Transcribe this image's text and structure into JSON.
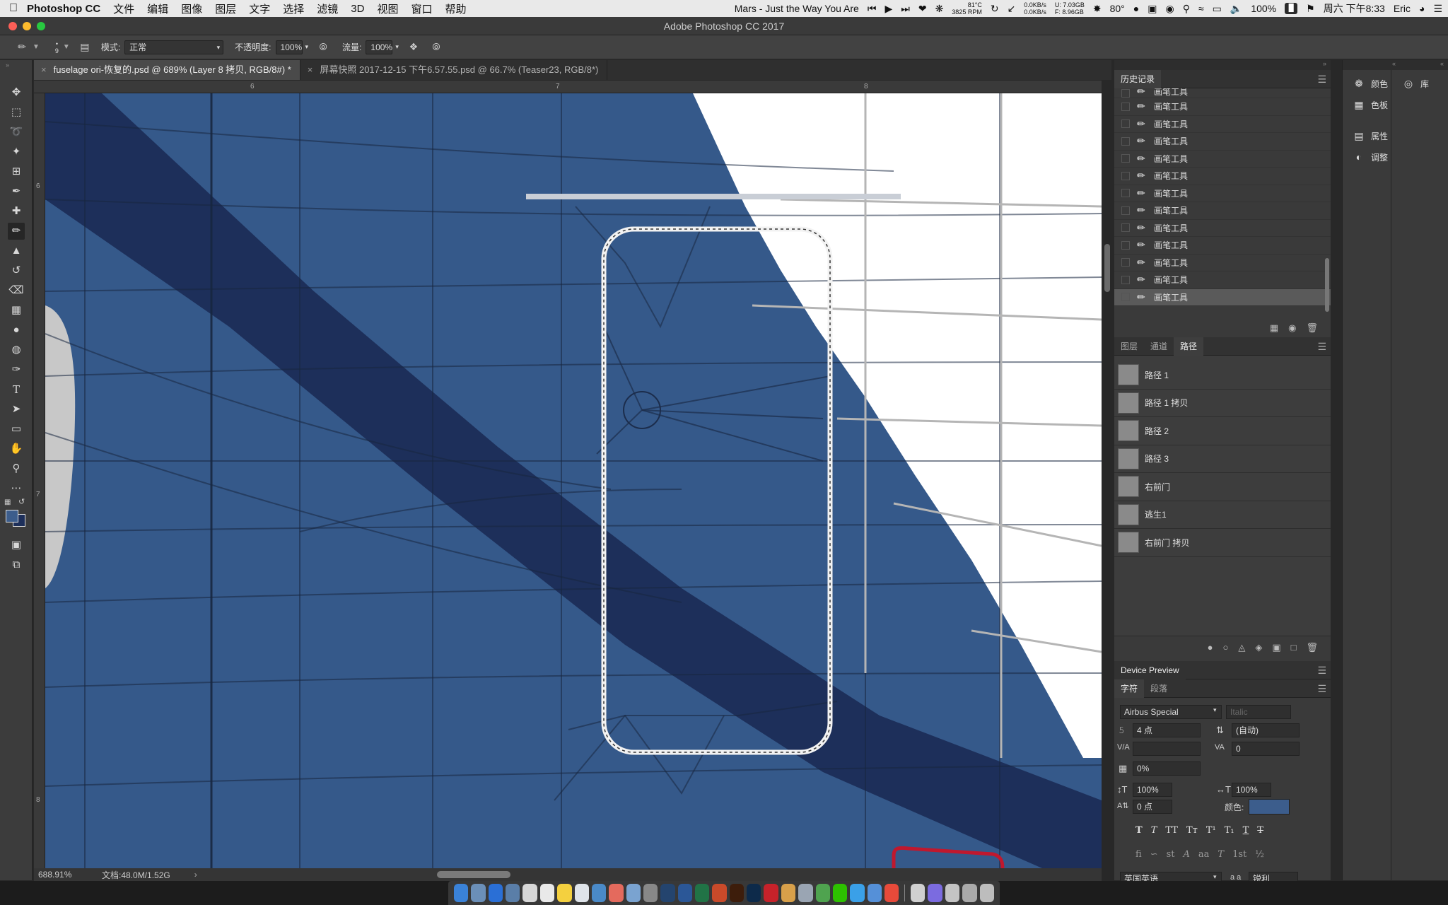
{
  "menubar": {
    "app_name": "Photoshop CC",
    "menus": [
      "文件",
      "编辑",
      "图像",
      "图层",
      "文字",
      "选择",
      "滤镜",
      "3D",
      "视图",
      "窗口",
      "帮助"
    ],
    "now_playing": "Mars - Just the Way You Are",
    "temp_small": "81°C",
    "rpm": "3825 RPM",
    "net_up": "0.0KB/s",
    "net_down": "0.0KB/s",
    "mem_u_label": "U:",
    "mem_f_label": "F:",
    "mem_used": "7.03GB",
    "mem_free": "8.96GB",
    "weather": "80°",
    "battery": "100%",
    "datetime": "周六 下午8:33",
    "user": "Eric"
  },
  "window": {
    "title": "Adobe Photoshop CC 2017"
  },
  "options": {
    "brush_size": "9",
    "mode_label": "模式:",
    "mode_value": "正常",
    "opacity_label": "不透明度:",
    "opacity_value": "100%",
    "flow_label": "流量:",
    "flow_value": "100%"
  },
  "doc_tabs": [
    {
      "label": "fuselage ori-恢复的.psd @ 689% (Layer 8 拷贝, RGB/8#) *",
      "active": true
    },
    {
      "label": "屏幕快照 2017-12-15 下午6.57.55.psd @ 66.7% (Teaser23, RGB/8*)",
      "active": false
    }
  ],
  "ruler": {
    "top_ticks": [
      "6",
      "7",
      "8"
    ],
    "left_ticks": [
      "6",
      "7",
      "8"
    ]
  },
  "status": {
    "zoom": "688.91%",
    "doc_size": "文档:48.0M/1.52G"
  },
  "history": {
    "title": "历史记录",
    "items": [
      "画笔工具",
      "画笔工具",
      "画笔工具",
      "画笔工具",
      "画笔工具",
      "画笔工具",
      "画笔工具",
      "画笔工具",
      "画笔工具",
      "画笔工具",
      "画笔工具",
      "画笔工具",
      "画笔工具"
    ]
  },
  "layers_tabs": [
    "图层",
    "通道",
    "路径"
  ],
  "paths": [
    "路径 1",
    "路径 1 拷贝",
    "路径 2",
    "路径 3",
    "右前门",
    "逃生1",
    "右前门 拷贝"
  ],
  "mini_panel": {
    "items": [
      "颜色",
      "色板",
      "属性",
      "调整"
    ],
    "library": "库"
  },
  "device_preview": {
    "title": "Device Preview"
  },
  "character": {
    "tabs": [
      "字符",
      "段落"
    ],
    "font_family": "Airbus Special",
    "font_style": "Italic",
    "font_size": "4 点",
    "leading": "(自动)",
    "kerning": "",
    "tracking": "0",
    "tsume": "0%",
    "vscale": "100%",
    "hscale": "100%",
    "baseline": "0 点",
    "color_label": "颜色:",
    "color_swatch": "#3c5d8c",
    "language": "英国英语",
    "aa_label": "a a",
    "antialias": "锐利"
  },
  "colors": {
    "fuselage_blue": "#35598a",
    "stripe_navy": "#1d2f5a",
    "white": "#ffffff",
    "red": "#c0182e"
  }
}
